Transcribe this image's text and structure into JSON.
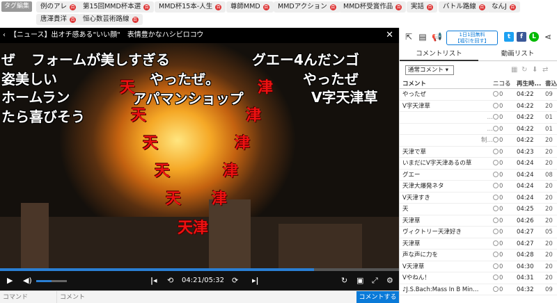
{
  "tagbar": {
    "edit_label": "タグ編集",
    "tags": [
      {
        "label": "例のアレ"
      },
      {
        "label": "第15回MMD杯本選"
      },
      {
        "label": "MMD杯15本-人生"
      },
      {
        "label": "尊師MMD"
      },
      {
        "label": "MMDアクション"
      },
      {
        "label": "MMD杯受賞作品"
      },
      {
        "label": "実話"
      },
      {
        "label": "バトル路線"
      },
      {
        "label": "なんJ"
      },
      {
        "label": "唐澤貴洋"
      },
      {
        "label": "恒心数芸術路線"
      }
    ],
    "dic_label": "百"
  },
  "player": {
    "title": "【ニュース】出オチ感ある\"いい顔\"　表情豊かなハシビロコウ",
    "close_label": "✕",
    "time_current": "04:21",
    "time_separator": "/",
    "time_total": "05:32",
    "progress_ratio": 0.787,
    "volume_ratio": 0.5,
    "overlay_comments": {
      "c1": "ぜ",
      "c2": "フォームが美しすぎる",
      "c3": "グエー4んだンゴ",
      "c4": "姿美しい",
      "c5": "やったぜ。",
      "c6": "やったぜ",
      "c7": "ホームラン",
      "c8": "アパマンショップ",
      "c9": "V字天津草",
      "c10": "たら喜びそう",
      "ten": "天",
      "tsu": "津",
      "tenshin": "天津"
    }
  },
  "comment_input": {
    "command_placeholder": "コマンド",
    "text_placeholder": "コメント",
    "submit_label": "コメントする"
  },
  "panel": {
    "ad_line1": "1日1回無料",
    "ad_line2": "【福引を回す】",
    "tabs": [
      "コメントリスト",
      "動画リスト"
    ],
    "filter_label": "通常コメント ▾",
    "columns": {
      "comment": "コメント",
      "nico": "ニコる",
      "time": "再生時...",
      "date": "書込"
    },
    "rows": [
      {
        "text": "やったぜ",
        "dots": false,
        "nico": "0",
        "time": "04:22",
        "date": "09"
      },
      {
        "text": "V字天津草",
        "dots": false,
        "nico": "0",
        "time": "04:22",
        "date": "20"
      },
      {
        "text": "…",
        "dots": true,
        "nico": "0",
        "time": "04:22",
        "date": "01"
      },
      {
        "text": "…",
        "dots": true,
        "nico": "0",
        "time": "04:22",
        "date": "01"
      },
      {
        "text": "制…",
        "dots": true,
        "nico": "0",
        "time": "04:22",
        "date": "20"
      },
      {
        "text": "天津で草",
        "dots": false,
        "nico": "0",
        "time": "04:23",
        "date": "20"
      },
      {
        "text": "いまだにV字天津あるの草",
        "dots": false,
        "nico": "0",
        "time": "04:24",
        "date": "20"
      },
      {
        "text": "グエー",
        "dots": false,
        "nico": "0",
        "time": "04:24",
        "date": "08"
      },
      {
        "text": "天津大爆発ネタ",
        "dots": false,
        "nico": "0",
        "time": "04:24",
        "date": "20"
      },
      {
        "text": "V天津すき",
        "dots": false,
        "nico": "0",
        "time": "04:24",
        "date": "20"
      },
      {
        "text": "天",
        "dots": false,
        "nico": "0",
        "time": "04:25",
        "date": "20"
      },
      {
        "text": "天津草",
        "dots": false,
        "nico": "0",
        "time": "04:26",
        "date": "20"
      },
      {
        "text": "ヴィクトリー天津好き",
        "dots": false,
        "nico": "0",
        "time": "04:27",
        "date": "05"
      },
      {
        "text": "天津草",
        "dots": false,
        "nico": "0",
        "time": "04:27",
        "date": "20"
      },
      {
        "text": "声な声に力を",
        "dots": false,
        "nico": "0",
        "time": "04:28",
        "date": "20"
      },
      {
        "text": "V天津草",
        "dots": false,
        "nico": "0",
        "time": "04:30",
        "date": "20"
      },
      {
        "text": "Vやねん！",
        "dots": false,
        "nico": "0",
        "time": "04:31",
        "date": "20"
      },
      {
        "text": "♪J.S.Bach:Mass In B Min…",
        "dots": false,
        "nico": "0",
        "time": "04:32",
        "date": "09"
      }
    ]
  },
  "colors": {
    "accent": "#0a7ad8",
    "dic": "#dd3333",
    "danmaku_red": "#ee1111"
  }
}
